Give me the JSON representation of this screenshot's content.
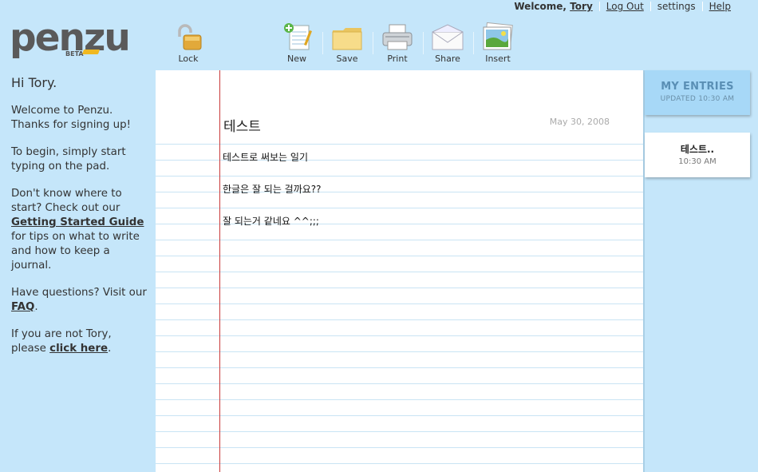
{
  "topbar": {
    "welcome_prefix": "Welcome,",
    "username": "Tory",
    "logout": "Log Out",
    "settings": "settings",
    "help": "Help"
  },
  "logo": {
    "text": "penzu",
    "badge": "BETA"
  },
  "toolbar": {
    "lock": "Lock",
    "new": "New",
    "save": "Save",
    "print": "Print",
    "share": "Share",
    "insert": "Insert"
  },
  "sidebar": {
    "greeting": "Hi Tory.",
    "welcome": "Welcome to Penzu. Thanks for signing up!",
    "begin": "To begin, simply start typing on the pad.",
    "start_prefix": "Don't know where to start? Check out our",
    "guide_link": "Getting Started Guide",
    "start_suffix": "for tips on what to write and how to keep a journal.",
    "questions_prefix": "Have questions? Visit our",
    "faq_link": "FAQ",
    "not_user_prefix": "If you are not Tory, please",
    "click_here": "click here"
  },
  "journal": {
    "title": "테스트",
    "date": "May 30, 2008",
    "lines": [
      "테스트로 써보는 일기",
      "한글은 잘 되는 걸까요??",
      "잘 되는거 같네요 ^^;;;"
    ]
  },
  "entries": {
    "header": "MY ENTRIES",
    "updated": "UPDATED 10:30 AM",
    "items": [
      {
        "title": "테스트..",
        "time": "10:30 AM"
      }
    ]
  },
  "colors": {
    "background": "#c5e6fa",
    "margin_line": "#c93a3a",
    "ruled_line": "#c9e4f4",
    "entries_header": "#a7d8f7"
  }
}
